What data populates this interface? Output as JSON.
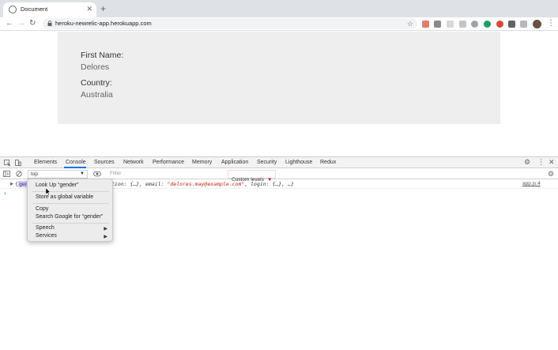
{
  "browser": {
    "tab_title": "Document",
    "tab_close": "✕",
    "new_tab": "+",
    "url": "heroku-newrelic-app.herokuapp.com",
    "nav": {
      "back": "←",
      "forward": "→",
      "reload": "↻"
    },
    "star": "☆",
    "menu": "⋮"
  },
  "page": {
    "first_name_label": "First Name:",
    "first_name_value": "Delores",
    "country_label": "Country:",
    "country_value": "Australia"
  },
  "devtools": {
    "tabs": [
      "Elements",
      "Console",
      "Sources",
      "Network",
      "Performance",
      "Memory",
      "Application",
      "Security",
      "Lighthouse",
      "Redux"
    ],
    "active_tab": "Console",
    "context": "top",
    "filter_placeholder": "Filter",
    "levels": "Custom levels",
    "log": {
      "brace": "{",
      "selected": "gen",
      "rest_prefix": "tion: {…}, email: ",
      "email": "\"delores.may@example.com\"",
      "rest_suffix": ", login: {…}, …}",
      "source": "app.js:4"
    },
    "prompt": "›"
  },
  "context_menu": {
    "items": [
      {
        "label": "Look Up “gender”"
      },
      {
        "label": "Store as global variable"
      },
      {
        "label": "Copy"
      },
      {
        "label": "Search Google for “gender”"
      },
      {
        "label": "Speech",
        "submenu": true
      },
      {
        "label": "Services",
        "submenu": true
      }
    ],
    "submenu_arrow": "▶"
  },
  "colors": {
    "accent": "#1a73e8",
    "card_bg": "#eeeeee",
    "string": "#c41a16",
    "property": "#881391"
  }
}
